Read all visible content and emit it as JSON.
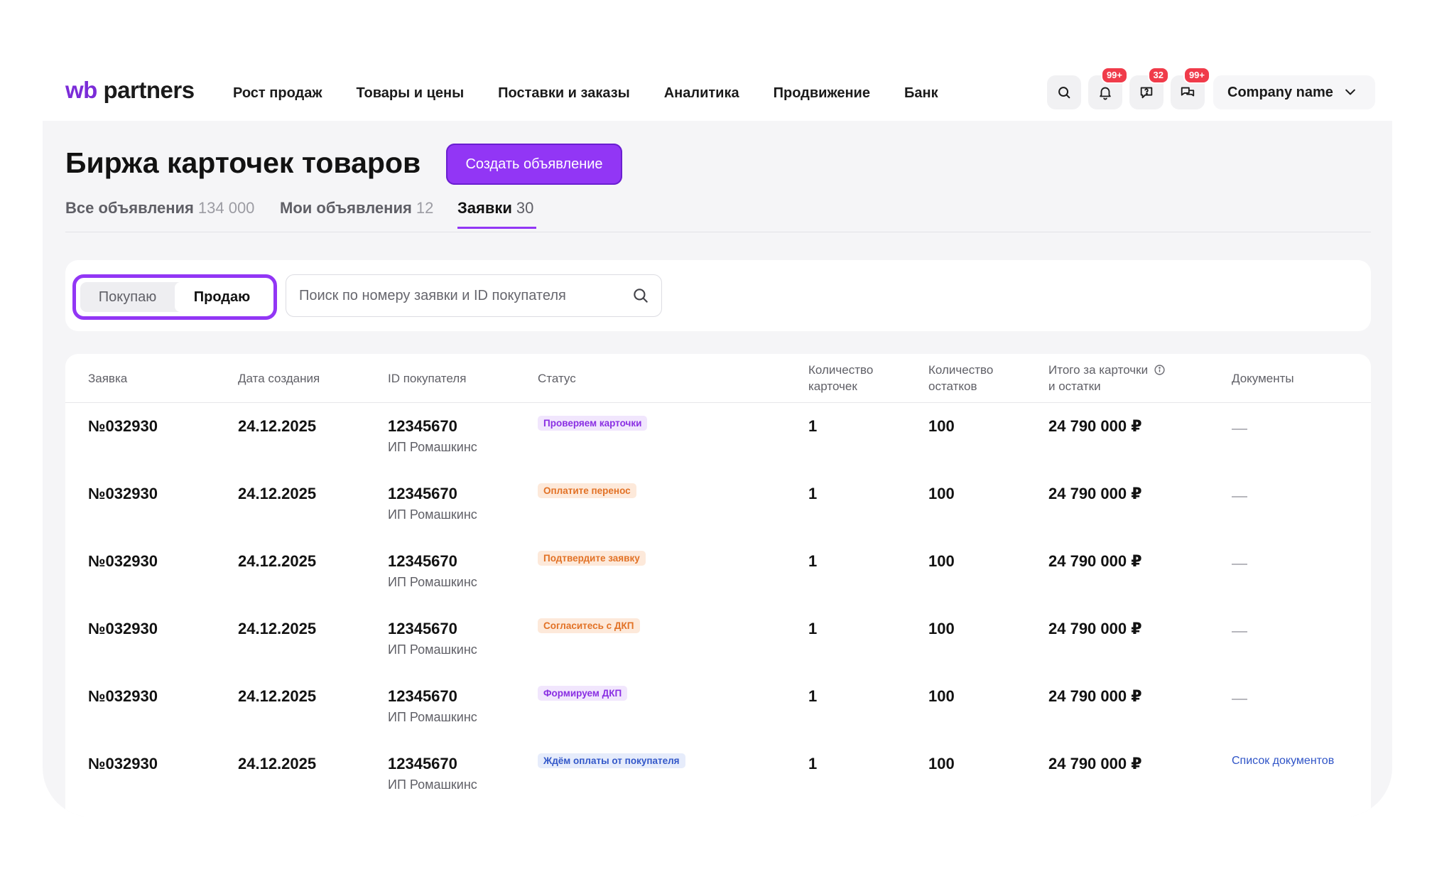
{
  "logo": {
    "part1": "wb",
    "part2": " partners"
  },
  "nav": [
    "Рост продаж",
    "Товары и цены",
    "Поставки и заказы",
    "Аналитика",
    "Продвижение",
    "Банк"
  ],
  "header_icons": {
    "search": {
      "icon": "search-icon"
    },
    "notifications": {
      "icon": "bell-icon",
      "badge": "99+"
    },
    "feedback": {
      "icon": "message-question-icon",
      "badge": "32"
    },
    "chats": {
      "icon": "chat-bubbles-icon",
      "badge": "99+"
    }
  },
  "company": {
    "name": "Company name",
    "icon": "chevron-down-icon"
  },
  "page": {
    "title": "Биржа карточек товаров",
    "create_button": "Создать объявление"
  },
  "tabs": [
    {
      "label": "Все объявления",
      "count": "134 000"
    },
    {
      "label": "Мои объявления",
      "count": "12"
    },
    {
      "label": "Заявки",
      "count": "30",
      "active": true
    }
  ],
  "filter": {
    "segment": {
      "buy": "Покупаю",
      "sell": "Продаю",
      "selected": "Продаю"
    },
    "search_placeholder": "Поиск по номеру заявки и ID покупателя"
  },
  "table": {
    "columns": [
      "Заявка",
      "Дата создания",
      "ID покупателя",
      "Статус",
      "Количество карточек",
      "Количество остатков",
      "Итого за карточки и остатки",
      "Документы"
    ],
    "column_lines": {
      "cards": [
        "Количество",
        "карточек"
      ],
      "stock": [
        "Количество",
        "остатков"
      ],
      "total": [
        "Итого за карточки",
        "и остатки"
      ]
    },
    "rows": [
      {
        "id": "№032930",
        "date": "24.12.2025",
        "buyer_id": "12345670",
        "buyer_name": "ИП Ромашкинс",
        "status": "Проверяем карточки",
        "status_color": "#8a2fe3",
        "cards": "1",
        "stock": "100",
        "total": "24 790 000 ₽",
        "docs": "—"
      },
      {
        "id": "№032930",
        "date": "24.12.2025",
        "buyer_id": "12345670",
        "buyer_name": "ИП Ромашкинс",
        "status": "Оплатите перенос",
        "status_color": "#e27226",
        "cards": "1",
        "stock": "100",
        "total": "24 790 000 ₽",
        "docs": "—"
      },
      {
        "id": "№032930",
        "date": "24.12.2025",
        "buyer_id": "12345670",
        "buyer_name": "ИП Ромашкинс",
        "status": "Подтвердите заявку",
        "status_color": "#e27226",
        "cards": "1",
        "stock": "100",
        "total": "24 790 000 ₽",
        "docs": "—"
      },
      {
        "id": "№032930",
        "date": "24.12.2025",
        "buyer_id": "12345670",
        "buyer_name": "ИП Ромашкинс",
        "status": "Согласитесь с ДКП",
        "status_color": "#e27226",
        "cards": "1",
        "stock": "100",
        "total": "24 790 000 ₽",
        "docs": "—"
      },
      {
        "id": "№032930",
        "date": "24.12.2025",
        "buyer_id": "12345670",
        "buyer_name": "ИП Ромашкинс",
        "status": "Формируем ДКП",
        "status_color": "#8a2fe3",
        "cards": "1",
        "stock": "100",
        "total": "24 790 000 ₽",
        "docs": "—"
      },
      {
        "id": "№032930",
        "date": "24.12.2025",
        "buyer_id": "12345670",
        "buyer_name": "ИП Ромашкинс",
        "status": "Ждём оплаты от покупателя",
        "status_color": "#3358c9",
        "cards": "1",
        "stock": "100",
        "total": "24 790 000 ₽",
        "docs": "Список документов"
      }
    ]
  },
  "colors": {
    "accent": "#9236f5",
    "badge": "#f03b4a",
    "link": "#2f54c7"
  }
}
